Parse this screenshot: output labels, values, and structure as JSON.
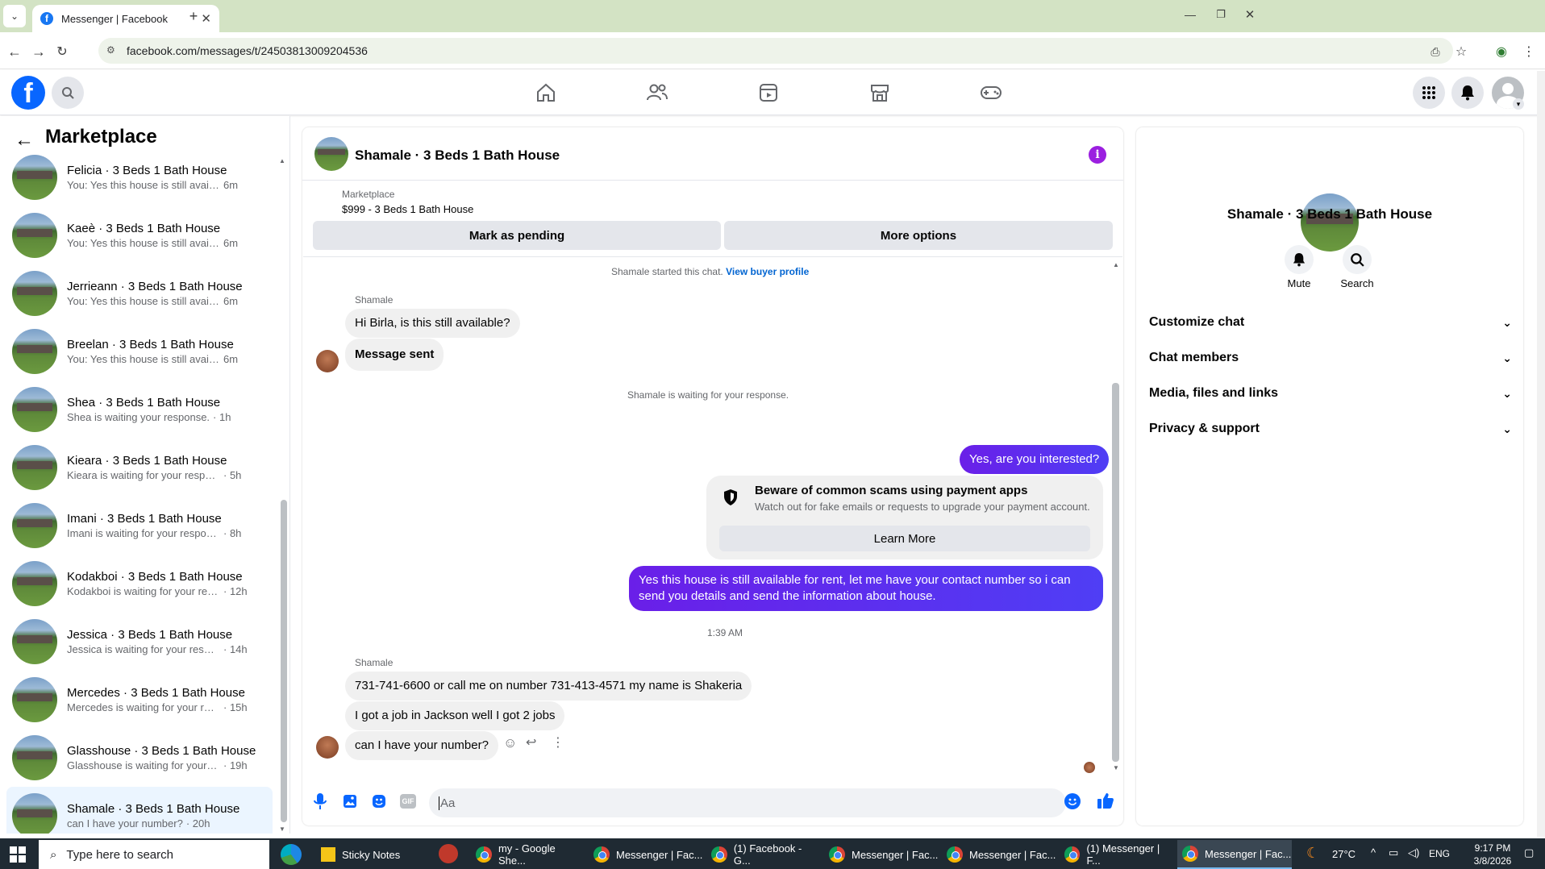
{
  "browser": {
    "tab_title": "Messenger | Facebook",
    "url": "facebook.com/messages/t/24503813009204536"
  },
  "sidebar": {
    "title": "Marketplace",
    "conversations": [
      {
        "name": "Felicia · 3 Beds 1 Bath House",
        "preview": "You: Yes this house is still available ...",
        "time": "6m"
      },
      {
        "name": "Kaeè · 3 Beds 1 Bath House",
        "preview": "You: Yes this house is still available ...",
        "time": "6m"
      },
      {
        "name": "Jerrieann · 3 Beds 1 Bath House",
        "preview": "You: Yes this house is still available ...",
        "time": "6m"
      },
      {
        "name": "Breelan · 3 Beds 1 Bath House",
        "preview": "You: Yes this house is still available ...",
        "time": "6m"
      },
      {
        "name": "Shea · 3 Beds 1 Bath House",
        "preview": "Shea is waiting your response.",
        "time": "· 1h"
      },
      {
        "name": "Kieara · 3 Beds 1 Bath House",
        "preview": "Kieara is waiting for your response.",
        "time": "· 5h"
      },
      {
        "name": "Imani · 3 Beds 1 Bath House",
        "preview": "Imani is waiting for your response.",
        "time": "· 8h"
      },
      {
        "name": "Kodakboi · 3 Beds 1 Bath House",
        "preview": "Kodakboi is waiting for your resp...",
        "time": "· 12h"
      },
      {
        "name": "Jessica · 3 Beds 1 Bath House",
        "preview": "Jessica is waiting for your response.",
        "time": "· 14h"
      },
      {
        "name": "Mercedes · 3 Beds 1 Bath House",
        "preview": "Mercedes is waiting for your resp...",
        "time": "· 15h"
      },
      {
        "name": "Glasshouse · 3 Beds 1 Bath House",
        "preview": "Glasshouse is waiting for your res...",
        "time": "· 19h"
      },
      {
        "name": "Shamale · 3 Beds 1 Bath House",
        "preview": "can I have your number?",
        "time": "· 20h"
      }
    ]
  },
  "chat": {
    "title": "Shamale · 3 Beds 1 Bath House",
    "listing_source": "Marketplace",
    "listing_title": "$999 - 3 Beds 1 Bath House",
    "mark_pending": "Mark as pending",
    "more_options": "More options",
    "started_text": "Shamale started this chat.",
    "view_buyer": "View buyer profile",
    "sender_label": "Shamale",
    "msg1": "Hi Birla, is this still available?",
    "msg2": "Message sent",
    "waiting": "Shamale is waiting for your response.",
    "out1": "Yes, are you interested?",
    "scam_title": "Beware of common scams using payment apps",
    "scam_body": "Watch out for fake emails or requests to upgrade your payment account.",
    "learn_more": "Learn More",
    "out2_line1": "Yes this house is still available for rent, let me have your contact number so i can",
    "out2_line2": "send you details and send the information about house.",
    "timestamp": "1:39 AM",
    "sender_label2": "Shamale",
    "msg3": "731-741-6600 or call me on number 731-413-4571 my name is Shakeria",
    "msg4": "I got a job in Jackson well  I got 2 jobs",
    "msg5": "can I have your number?",
    "composer_placeholder": "Aa"
  },
  "details": {
    "title": "Shamale · 3 Beds 1 Bath House",
    "mute": "Mute",
    "search": "Search",
    "sections": [
      "Customize chat",
      "Chat members",
      "Media, files and links",
      "Privacy & support"
    ]
  },
  "taskbar": {
    "search_placeholder": "Type here to search",
    "items": [
      "Sticky Notes",
      "my - Google She...",
      "Messenger | Fac...",
      "(1) Facebook - G...",
      "Messenger | Fac...",
      "Messenger | Fac...",
      "(1) Messenger | F...",
      "Messenger | Fac..."
    ],
    "temperature": "27°C",
    "language": "ENG",
    "time": "9:17 PM",
    "date": "3/8/2026"
  },
  "colors": {
    "accent": "#5e1cf1",
    "fb_blue": "#0866ff",
    "active_conv": "#ebf5ff"
  }
}
